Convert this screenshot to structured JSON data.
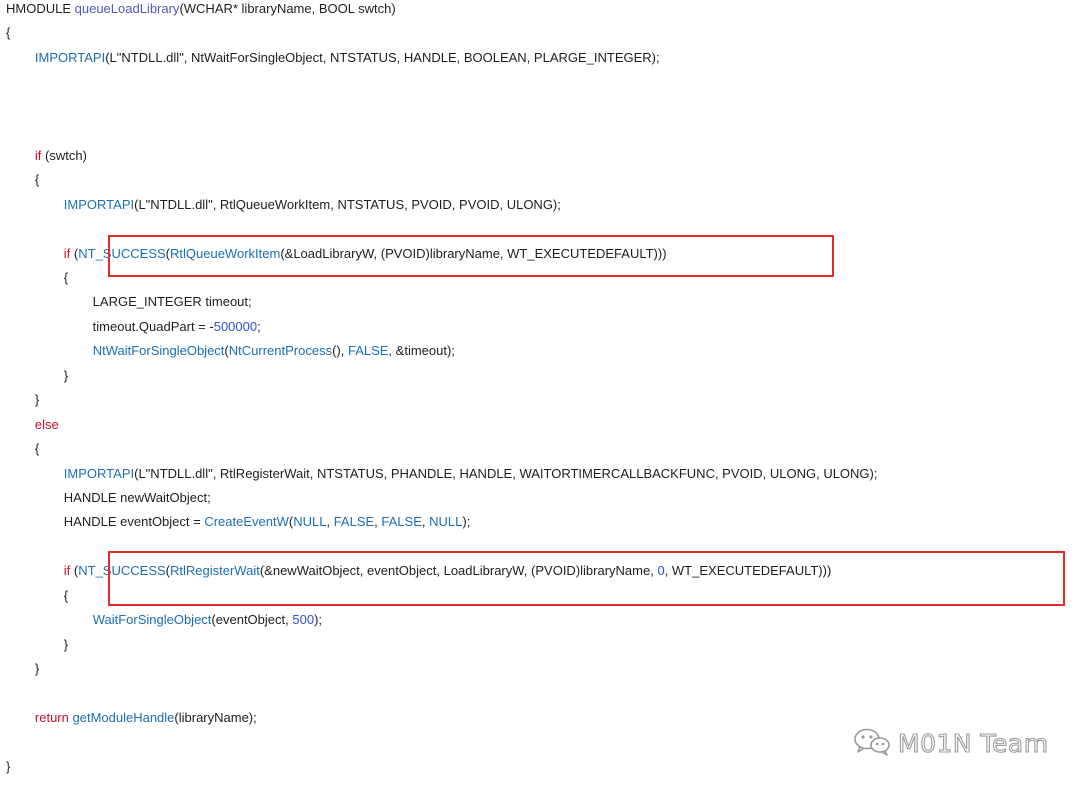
{
  "code": {
    "lines": [
      {
        "tokens": [
          {
            "t": "HMODULE ",
            "c": "plain"
          },
          {
            "t": "queueLoadLibrary",
            "c": "fn"
          },
          {
            "t": "(WCHAR* libraryName, BOOL swtch)",
            "c": "plain"
          }
        ]
      },
      {
        "tokens": [
          {
            "t": "{",
            "c": "plain"
          }
        ]
      },
      {
        "tokens": [
          {
            "t": "        ",
            "c": "plain"
          },
          {
            "t": "IMPORTAPI",
            "c": "api"
          },
          {
            "t": "(L\"NTDLL.dll\", NtWaitForSingleObject, NTSTATUS, HANDLE, BOOLEAN, PLARGE_INTEGER);",
            "c": "plain"
          }
        ]
      },
      {
        "tokens": []
      },
      {
        "tokens": []
      },
      {
        "tokens": []
      },
      {
        "tokens": [
          {
            "t": "        ",
            "c": "plain"
          },
          {
            "t": "if",
            "c": "kw"
          },
          {
            "t": " (swtch)",
            "c": "plain"
          }
        ]
      },
      {
        "tokens": [
          {
            "t": "        {",
            "c": "plain"
          }
        ]
      },
      {
        "tokens": [
          {
            "t": "                ",
            "c": "plain"
          },
          {
            "t": "IMPORTAPI",
            "c": "api"
          },
          {
            "t": "(L\"NTDLL.dll\", RtlQueueWorkItem, NTSTATUS, PVOID, PVOID, ULONG);",
            "c": "plain"
          }
        ]
      },
      {
        "tokens": []
      },
      {
        "tokens": [
          {
            "t": "                ",
            "c": "plain"
          },
          {
            "t": "if",
            "c": "kw"
          },
          {
            "t": " (",
            "c": "plain"
          },
          {
            "t": "NT_SUCCESS",
            "c": "api"
          },
          {
            "t": "(",
            "c": "plain"
          },
          {
            "t": "RtlQueueWorkItem",
            "c": "api"
          },
          {
            "t": "(&LoadLibraryW, (PVOID)libraryName, WT_EXECUTEDEFAULT)))",
            "c": "plain"
          }
        ]
      },
      {
        "tokens": [
          {
            "t": "                {",
            "c": "plain"
          }
        ]
      },
      {
        "tokens": [
          {
            "t": "                        LARGE_INTEGER timeout;",
            "c": "plain"
          }
        ]
      },
      {
        "tokens": [
          {
            "t": "                        timeout.QuadPart = -",
            "c": "plain"
          },
          {
            "t": "500000",
            "c": "num"
          },
          {
            "t": ";",
            "c": "plain"
          }
        ]
      },
      {
        "tokens": [
          {
            "t": "                        ",
            "c": "plain"
          },
          {
            "t": "NtWaitForSingleObject",
            "c": "api"
          },
          {
            "t": "(",
            "c": "plain"
          },
          {
            "t": "NtCurrentProcess",
            "c": "api"
          },
          {
            "t": "(), ",
            "c": "plain"
          },
          {
            "t": "FALSE",
            "c": "api"
          },
          {
            "t": ", &timeout);",
            "c": "plain"
          }
        ]
      },
      {
        "tokens": [
          {
            "t": "                }",
            "c": "plain"
          }
        ]
      },
      {
        "tokens": [
          {
            "t": "        }",
            "c": "plain"
          }
        ]
      },
      {
        "tokens": [
          {
            "t": "        ",
            "c": "plain"
          },
          {
            "t": "else",
            "c": "kw"
          }
        ]
      },
      {
        "tokens": [
          {
            "t": "        {",
            "c": "plain"
          }
        ]
      },
      {
        "tokens": [
          {
            "t": "                ",
            "c": "plain"
          },
          {
            "t": "IMPORTAPI",
            "c": "api"
          },
          {
            "t": "(L\"NTDLL.dll\", RtlRegisterWait, NTSTATUS, PHANDLE, HANDLE, WAITORTIMERCALLBACKFUNC, PVOID, ULONG, ULONG);",
            "c": "plain"
          }
        ]
      },
      {
        "tokens": [
          {
            "t": "                HANDLE newWaitObject;",
            "c": "plain"
          }
        ]
      },
      {
        "tokens": [
          {
            "t": "                HANDLE eventObject = ",
            "c": "plain"
          },
          {
            "t": "CreateEventW",
            "c": "api"
          },
          {
            "t": "(",
            "c": "plain"
          },
          {
            "t": "NULL",
            "c": "api"
          },
          {
            "t": ", ",
            "c": "plain"
          },
          {
            "t": "FALSE",
            "c": "api"
          },
          {
            "t": ", ",
            "c": "plain"
          },
          {
            "t": "FALSE",
            "c": "api"
          },
          {
            "t": ", ",
            "c": "plain"
          },
          {
            "t": "NULL",
            "c": "api"
          },
          {
            "t": ");",
            "c": "plain"
          }
        ]
      },
      {
        "tokens": []
      },
      {
        "tokens": [
          {
            "t": "                ",
            "c": "plain"
          },
          {
            "t": "if",
            "c": "kw"
          },
          {
            "t": " (",
            "c": "plain"
          },
          {
            "t": "NT_SUCCESS",
            "c": "api"
          },
          {
            "t": "(",
            "c": "plain"
          },
          {
            "t": "RtlRegisterWait",
            "c": "api"
          },
          {
            "t": "(&newWaitObject, eventObject, LoadLibraryW, (PVOID)libraryName, ",
            "c": "plain"
          },
          {
            "t": "0",
            "c": "num"
          },
          {
            "t": ", WT_EXECUTEDEFAULT)))",
            "c": "plain"
          }
        ]
      },
      {
        "tokens": [
          {
            "t": "                {",
            "c": "plain"
          }
        ]
      },
      {
        "tokens": [
          {
            "t": "                        ",
            "c": "plain"
          },
          {
            "t": "WaitForSingleObject",
            "c": "api"
          },
          {
            "t": "(eventObject, ",
            "c": "plain"
          },
          {
            "t": "500",
            "c": "num"
          },
          {
            "t": ");",
            "c": "plain"
          }
        ]
      },
      {
        "tokens": [
          {
            "t": "                }",
            "c": "plain"
          }
        ]
      },
      {
        "tokens": [
          {
            "t": "        }",
            "c": "plain"
          }
        ]
      },
      {
        "tokens": []
      },
      {
        "tokens": [
          {
            "t": "        ",
            "c": "plain"
          },
          {
            "t": "return",
            "c": "kw"
          },
          {
            "t": " ",
            "c": "plain"
          },
          {
            "t": "getModuleHandle",
            "c": "api"
          },
          {
            "t": "(libraryName);",
            "c": "plain"
          }
        ]
      },
      {
        "tokens": []
      },
      {
        "tokens": [
          {
            "t": "}",
            "c": "plain"
          }
        ]
      }
    ]
  },
  "highlights": [
    {
      "label": "rtl-queue-work-item-condition"
    },
    {
      "label": "rtl-register-wait-condition"
    }
  ],
  "watermark": {
    "text": "M01N Team",
    "icon": "wechat-icon"
  },
  "colors": {
    "keyword": "#c8102e",
    "function_def": "#4e5bb5",
    "api_call": "#1a6fb0",
    "number": "#2f4fd6",
    "text": "#1e1e1e",
    "highlight_border": "#e32a2a",
    "watermark": "#9a9a9a"
  }
}
